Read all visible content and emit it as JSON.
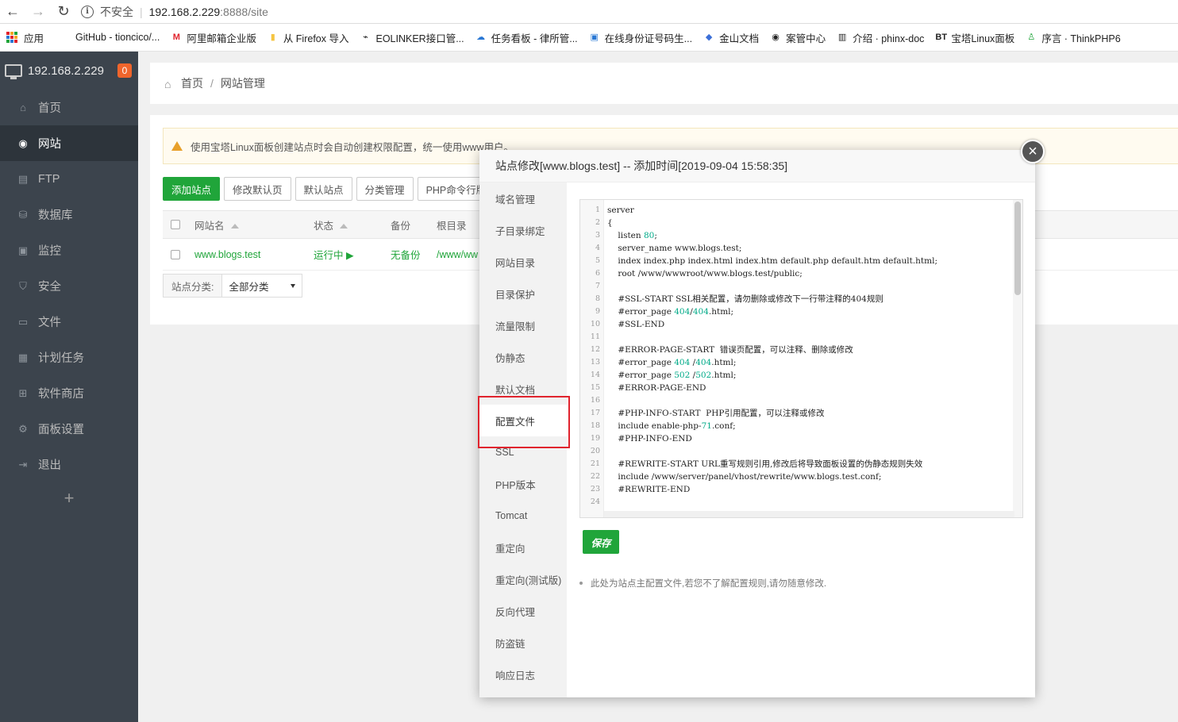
{
  "browser": {
    "security_label": "不安全",
    "url_host": "192.168.2.229",
    "url_rest": ":8888/site",
    "bookmarks": [
      {
        "label": "应用",
        "icon": "apps-icon"
      },
      {
        "label": "GitHub - tioncico/...",
        "icon": "github-icon"
      },
      {
        "label": "阿里邮箱企业版",
        "icon": "mail-icon",
        "color": "#e0232d"
      },
      {
        "label": "从 Firefox 导入",
        "icon": "folder-icon",
        "color": "#f5c542"
      },
      {
        "label": "EOLINKER接口管...",
        "icon": "eolinker-icon"
      },
      {
        "label": "任务看板 - 律所管...",
        "icon": "cloud-icon",
        "color": "#2a78d4"
      },
      {
        "label": "在线身份证号码生...",
        "icon": "id-icon",
        "color": "#2a78d4"
      },
      {
        "label": "金山文档",
        "icon": "doc-icon",
        "color": "#3b6fd8"
      },
      {
        "label": "案管中心",
        "icon": "globe-icon"
      },
      {
        "label": "介绍 · phinx-doc",
        "icon": "book-icon"
      },
      {
        "label": "宝塔Linux面板",
        "icon": "bt-icon"
      },
      {
        "label": "序言 · ThinkPHP6",
        "icon": "person-icon",
        "color": "#20a53a"
      }
    ]
  },
  "sidebar": {
    "host": "192.168.2.229",
    "badge": "0",
    "items": [
      {
        "label": "首页",
        "icon": "home-icon",
        "glyph": "⌂",
        "active": false
      },
      {
        "label": "网站",
        "icon": "globe-icon",
        "glyph": "◉",
        "active": true
      },
      {
        "label": "FTP",
        "icon": "ftp-icon",
        "glyph": "▤",
        "active": false
      },
      {
        "label": "数据库",
        "icon": "database-icon",
        "glyph": "⛁",
        "active": false
      },
      {
        "label": "监控",
        "icon": "monitor-icon",
        "glyph": "▣",
        "active": false
      },
      {
        "label": "安全",
        "icon": "shield-icon",
        "glyph": "⛉",
        "active": false
      },
      {
        "label": "文件",
        "icon": "folder-icon",
        "glyph": "▭",
        "active": false
      },
      {
        "label": "计划任务",
        "icon": "calendar-icon",
        "glyph": "▦",
        "active": false
      },
      {
        "label": "软件商店",
        "icon": "apps-icon",
        "glyph": "⊞",
        "active": false
      },
      {
        "label": "面板设置",
        "icon": "gear-icon",
        "glyph": "⚙",
        "active": false
      },
      {
        "label": "退出",
        "icon": "logout-icon",
        "glyph": "⇥",
        "active": false
      }
    ],
    "add": "+"
  },
  "breadcrumb": {
    "home": "首页",
    "sep": "/",
    "current": "网站管理"
  },
  "warning": "使用宝塔Linux面板创建站点时会自动创建权限配置，统一使用www用户。",
  "toolbar": [
    "添加站点",
    "修改默认页",
    "默认站点",
    "分类管理",
    "PHP命令行版本"
  ],
  "table": {
    "headers": {
      "name": "网站名",
      "status": "状态",
      "backup": "备份",
      "root": "根目录"
    },
    "rows": [
      {
        "name": "www.blogs.test",
        "status": "运行中 ▶",
        "backup": "无备份",
        "root": "/www/ww"
      }
    ]
  },
  "filter": {
    "label": "站点分类:",
    "value": "全部分类"
  },
  "modal": {
    "title": "站点修改[www.blogs.test] -- 添加时间[2019-09-04 15:58:35]",
    "close": "×",
    "nav": [
      "域名管理",
      "子目录绑定",
      "网站目录",
      "目录保护",
      "流量限制",
      "伪静态",
      "默认文档",
      "配置文件",
      "SSL",
      "PHP版本",
      "Tomcat",
      "重定向",
      "重定向(测试版)",
      "反向代理",
      "防盗链",
      "响应日志"
    ],
    "active_nav": "配置文件",
    "code_lines": [
      "server",
      "{",
      "    listen 80;",
      "    server_name www.blogs.test;",
      "    index index.php index.html index.htm default.php default.htm default.html;",
      "    root /www/wwwroot/www.blogs.test/public;",
      "",
      "    #SSL-START SSL相关配置，请勿删除或修改下一行带注释的404规则",
      "    #error_page 404/404.html;",
      "    #SSL-END",
      "",
      "    #ERROR-PAGE-START  错误页配置，可以注释、删除或修改",
      "    #error_page 404 /404.html;",
      "    #error_page 502 /502.html;",
      "    #ERROR-PAGE-END",
      "",
      "    #PHP-INFO-START  PHP引用配置，可以注释或修改",
      "    include enable-php-71.conf;",
      "    #PHP-INFO-END",
      "",
      "    #REWRITE-START URL重写规则引用,修改后将导致面板设置的伪静态规则失效",
      "    include /www/server/panel/vhost/rewrite/www.blogs.test.conf;",
      "    #REWRITE-END",
      ""
    ],
    "save": "保存",
    "note": "此处为站点主配置文件,若您不了解配置规则,请勿随意修改."
  }
}
